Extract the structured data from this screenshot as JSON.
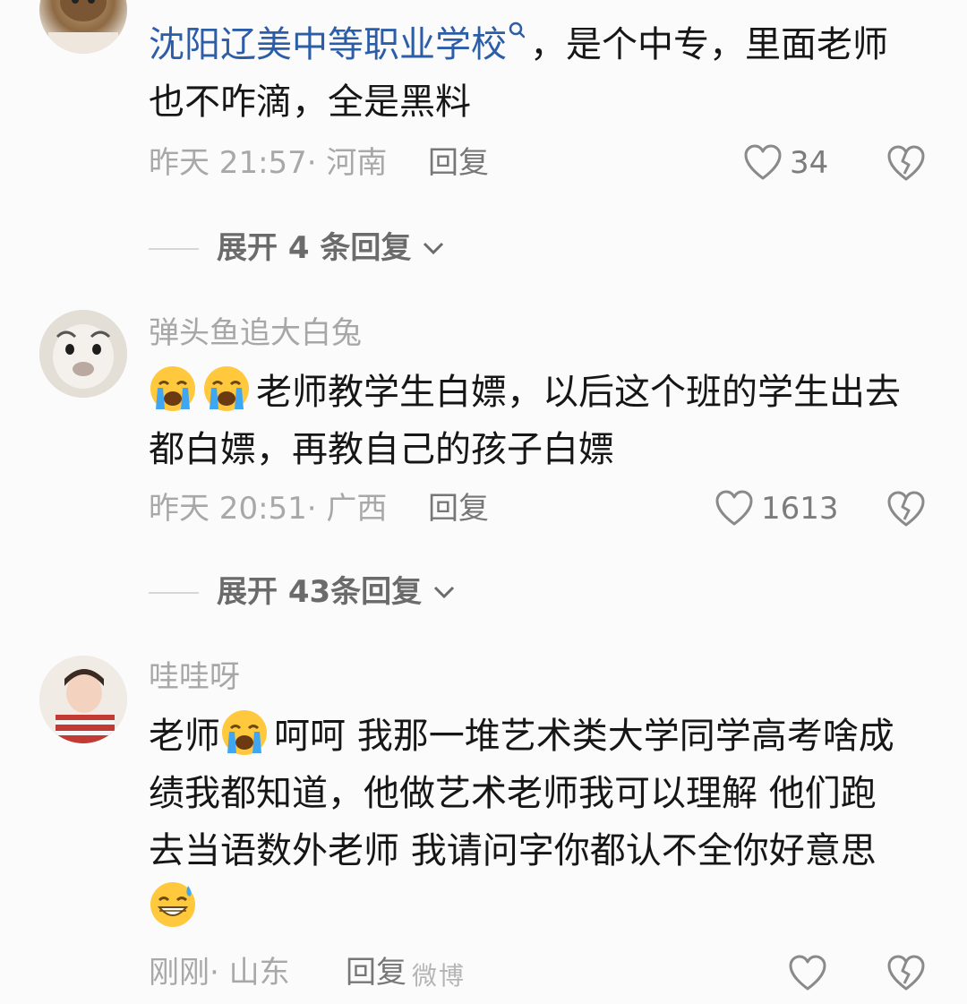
{
  "comments": [
    {
      "text_link": "沈阳辽美中等职业学校",
      "text_rest": "，是个中专，里面老师",
      "text_line2": "也不咋滴，全是黑料",
      "time": "昨天 21:57",
      "region": "· 河南",
      "reply_label": "回复",
      "likes": "34",
      "expand": {
        "prefix": "展开",
        "count": "4",
        "suffix": "条回复"
      }
    },
    {
      "username": "弹头鱼追大白兔",
      "emoji": [
        "loudly-crying-face",
        "loudly-crying-face"
      ],
      "text_line1": "老师教学生白嫖，以后这个班的学生出去",
      "text_line2": "都白嫖，再教自己的孩子白嫖",
      "time": "昨天 20:51",
      "region": "· 广西",
      "reply_label": "回复",
      "likes": "1613",
      "expand": {
        "prefix": "展开",
        "count": "43",
        "suffix": "条回复"
      }
    },
    {
      "username": "哇哇呀",
      "text_line1_a": "老师",
      "text_line1_b": "呵呵 我那一堆艺术类大学同学高考啥成",
      "text_line2": "绩我都知道，他做艺术老师我可以理解 他们跑",
      "text_line3": "去当语数外老师 我请问字你都认不全你好意思",
      "emoji_inline": "loudly-crying-face",
      "emoji_end": "grinning-face-with-sweat",
      "time": "刚刚",
      "region": "· 山东",
      "reply_label": "回复",
      "likes": ""
    }
  ],
  "watermark": "微博",
  "icons": {
    "like": "heart-outline-icon",
    "dislike": "broken-heart-icon",
    "expand": "chevron-down-icon",
    "search": "search-icon"
  },
  "colors": {
    "link": "#2c5ea8",
    "meta": "#a8a8a8",
    "username": "#a7a7a7",
    "emoji_yellow": "#ffc83d"
  }
}
